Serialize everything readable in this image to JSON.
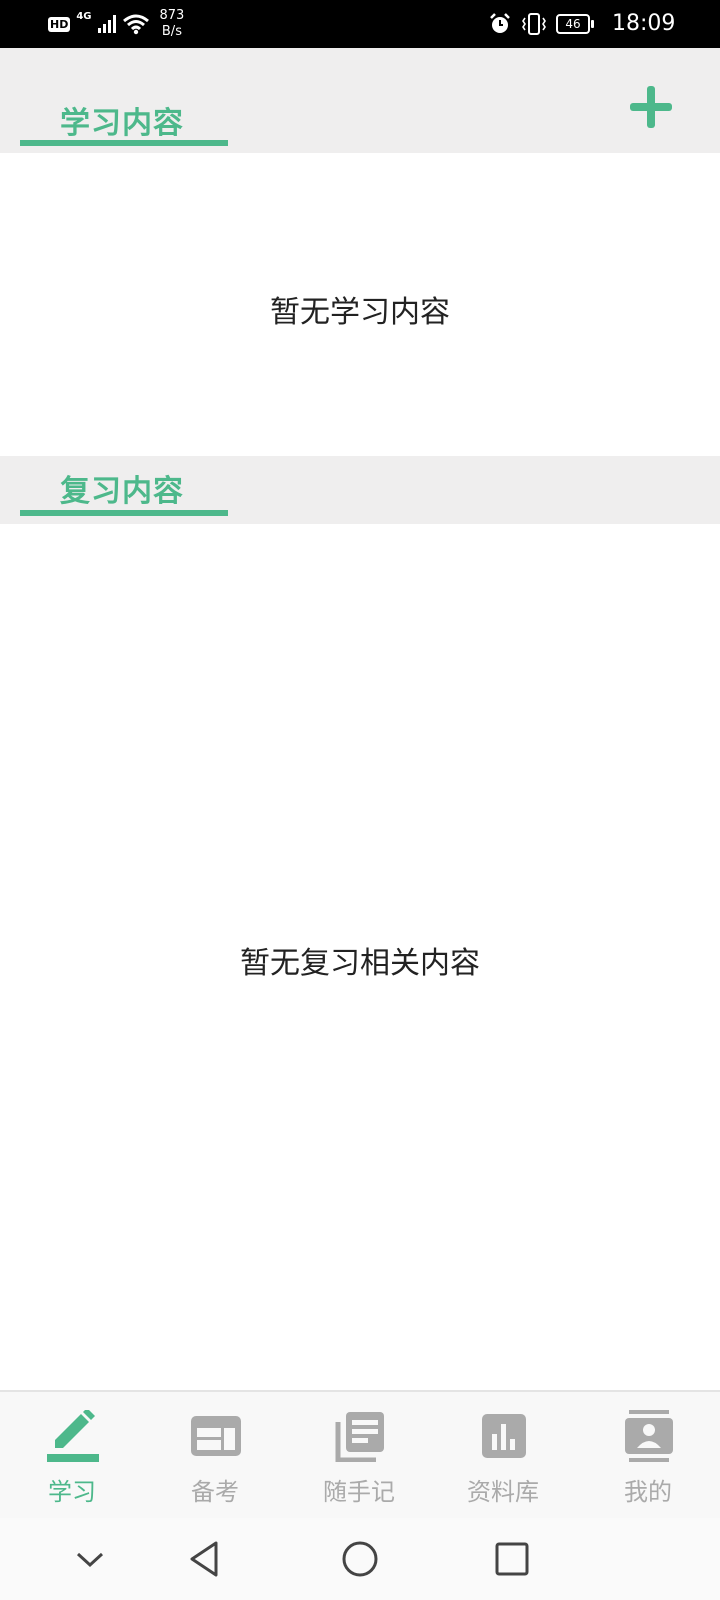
{
  "status_bar": {
    "hd": "HD",
    "network": "4G",
    "speed_value": "873",
    "speed_unit": "B/s",
    "battery": "46",
    "time": "18:09"
  },
  "learning_section": {
    "title": "学习内容",
    "empty_text": "暂无学习内容"
  },
  "review_section": {
    "title": "复习内容",
    "empty_text": "暂无复习相关内容"
  },
  "bottom_nav": {
    "items": [
      {
        "label": "学习",
        "icon": "pencil-icon",
        "active": true
      },
      {
        "label": "备考",
        "icon": "newspaper-icon",
        "active": false
      },
      {
        "label": "随手记",
        "icon": "notes-icon",
        "active": false
      },
      {
        "label": "资料库",
        "icon": "bar-chart-icon",
        "active": false
      },
      {
        "label": "我的",
        "icon": "contact-icon",
        "active": false
      }
    ]
  },
  "colors": {
    "accent": "#4db88b",
    "section_bg": "#efeeee",
    "inactive": "#aaaaaa"
  }
}
